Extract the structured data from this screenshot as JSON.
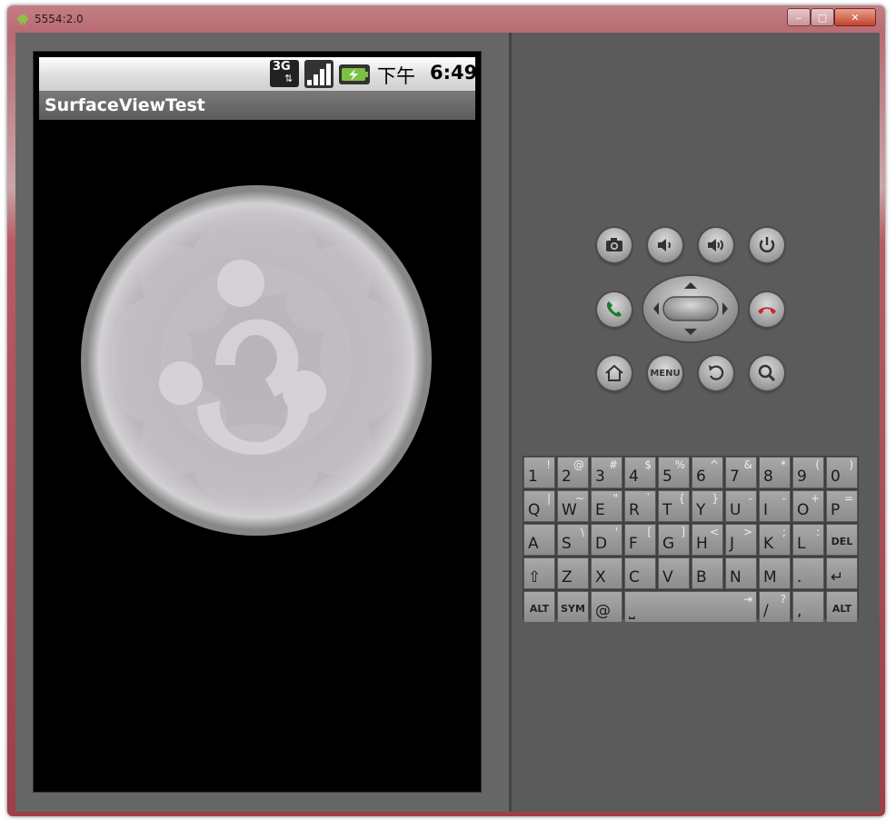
{
  "window": {
    "title": "5554:2.0",
    "minimize_glyph": "‒",
    "maximize_glyph": "□",
    "close_glyph": "✕"
  },
  "device": {
    "status_bar": {
      "network": "3G",
      "clock_prefix": "下午",
      "clock_time": "6:49"
    },
    "app_title": "SurfaceViewTest"
  },
  "controls": {
    "top_row": [
      "camera-icon",
      "volume-down-icon",
      "volume-up-icon",
      "power-icon"
    ],
    "call_button": "call-icon",
    "end_call_button": "end-call-icon",
    "bottom_row": [
      "home-icon",
      "menu-button",
      "back-icon",
      "search-icon"
    ],
    "menu_label": "MENU"
  },
  "keyboard": {
    "rows": [
      [
        {
          "m": "1",
          "a": "!"
        },
        {
          "m": "2",
          "a": "@"
        },
        {
          "m": "3",
          "a": "#"
        },
        {
          "m": "4",
          "a": "$"
        },
        {
          "m": "5",
          "a": "%"
        },
        {
          "m": "6",
          "a": "^"
        },
        {
          "m": "7",
          "a": "&"
        },
        {
          "m": "8",
          "a": "*"
        },
        {
          "m": "9",
          "a": "("
        },
        {
          "m": "0",
          "a": ")"
        }
      ],
      [
        {
          "m": "Q",
          "a": "|"
        },
        {
          "m": "W",
          "a": "~"
        },
        {
          "m": "E",
          "a": "\""
        },
        {
          "m": "R",
          "a": "`"
        },
        {
          "m": "T",
          "a": "{"
        },
        {
          "m": "Y",
          "a": "}"
        },
        {
          "m": "U",
          "a": "-"
        },
        {
          "m": "I",
          "a": "-"
        },
        {
          "m": "O",
          "a": "+"
        },
        {
          "m": "P",
          "a": "="
        }
      ],
      [
        {
          "m": "A",
          "a": ""
        },
        {
          "m": "S",
          "a": "\\"
        },
        {
          "m": "D",
          "a": "'"
        },
        {
          "m": "F",
          "a": "["
        },
        {
          "m": "G",
          "a": "]"
        },
        {
          "m": "H",
          "a": "<"
        },
        {
          "m": "J",
          "a": ">"
        },
        {
          "m": "K",
          "a": ";"
        },
        {
          "m": "L",
          "a": ":"
        },
        {
          "m": "DEL",
          "a": ""
        }
      ],
      [
        {
          "m": "⇧",
          "a": ""
        },
        {
          "m": "Z",
          "a": ""
        },
        {
          "m": "X",
          "a": ""
        },
        {
          "m": "C",
          "a": ""
        },
        {
          "m": "V",
          "a": ""
        },
        {
          "m": "B",
          "a": ""
        },
        {
          "m": "N",
          "a": ""
        },
        {
          "m": "M",
          "a": ""
        },
        {
          "m": ".",
          "a": ""
        },
        {
          "m": "↵",
          "a": ""
        }
      ],
      [
        {
          "m": "ALT",
          "a": ""
        },
        {
          "m": "SYM",
          "a": ""
        },
        {
          "m": "@",
          "a": ""
        },
        {
          "m": "⎵",
          "a": "⇥"
        },
        {
          "m": "/",
          "a": "?"
        },
        {
          "m": ",",
          "a": ""
        },
        {
          "m": "ALT",
          "a": ""
        }
      ]
    ]
  }
}
